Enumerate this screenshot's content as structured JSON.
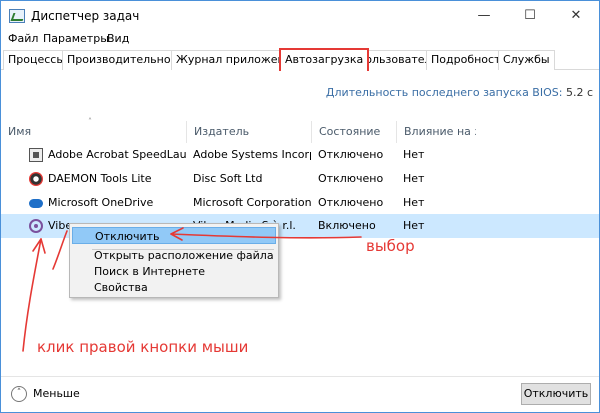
{
  "window": {
    "title": "Диспетчер задач",
    "controls": {
      "minimize": "—",
      "maximize": "☐",
      "close": "✕"
    }
  },
  "menu": [
    "Файл",
    "Параметры",
    "Вид"
  ],
  "tabs": [
    {
      "label": "Процессы",
      "active": false
    },
    {
      "label": "Производительность",
      "active": false
    },
    {
      "label": "Журнал приложений",
      "active": false
    },
    {
      "label": "Автозагрузка",
      "active": true
    },
    {
      "label": "Пользователи",
      "active": false
    },
    {
      "label": "Подробности",
      "active": false
    },
    {
      "label": "Службы",
      "active": false
    }
  ],
  "bios": {
    "label": "Длительность последнего запуска BIOS:",
    "value": "5.2 с"
  },
  "columns": {
    "name": "Имя",
    "publisher": "Издатель",
    "status": "Состояние",
    "impact": "Влияние на за..."
  },
  "rows": [
    {
      "icon": "acrobat-icon",
      "name": "Adobe Acrobat SpeedLaunc...",
      "publisher": "Adobe Systems Incorpor...",
      "status": "Отключено",
      "impact": "Нет"
    },
    {
      "icon": "daemon-tools-icon",
      "name": "DAEMON Tools Lite",
      "publisher": "Disc Soft Ltd",
      "status": "Отключено",
      "impact": "Нет"
    },
    {
      "icon": "onedrive-icon",
      "name": "Microsoft OneDrive",
      "publisher": "Microsoft Corporation",
      "status": "Отключено",
      "impact": "Нет"
    },
    {
      "icon": "viber-icon",
      "name": "Viber",
      "publisher": "Viber Media S.à r.l.",
      "status": "Включено",
      "impact": "Нет",
      "selected": true
    }
  ],
  "context_menu": {
    "disable": "Отключить",
    "open_location": "Открыть расположение файла",
    "search_online": "Поиск в Интернете",
    "properties": "Свойства"
  },
  "annotations": {
    "choice": "выбор",
    "right_click": "клик правой кнопки мыши",
    "color": "#e53935"
  },
  "footer": {
    "less": "Меньше",
    "disable_button": "Отключить"
  }
}
